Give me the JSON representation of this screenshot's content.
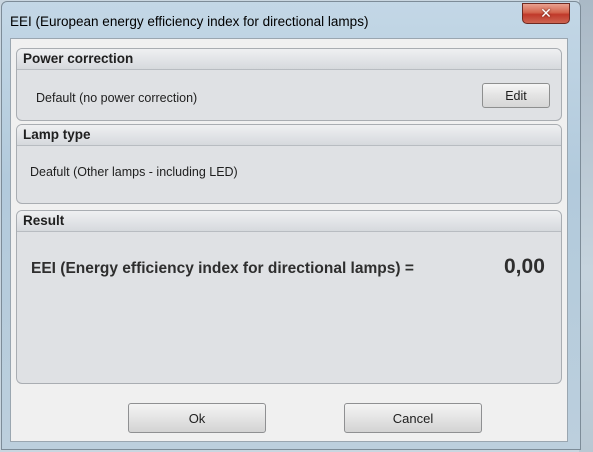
{
  "window": {
    "title": "EEI (European energy efficiency index for directional lamps)",
    "close_icon": "close-icon",
    "close_glyph": "✕"
  },
  "power_correction": {
    "header": "Power correction",
    "value": "Default (no power correction)",
    "edit_label": "Edit"
  },
  "lamp_type": {
    "header": "Lamp type",
    "value": "Deafult (Other lamps - including LED)"
  },
  "result": {
    "header": "Result",
    "label": "EEI (Energy efficiency index for directional lamps) =",
    "value": "0,00"
  },
  "buttons": {
    "ok_label": "Ok",
    "cancel_label": "Cancel"
  },
  "colors": {
    "title_bar": "#b9cfe0",
    "close_button": "#c9483a",
    "group_background": "#dfe1e4"
  }
}
